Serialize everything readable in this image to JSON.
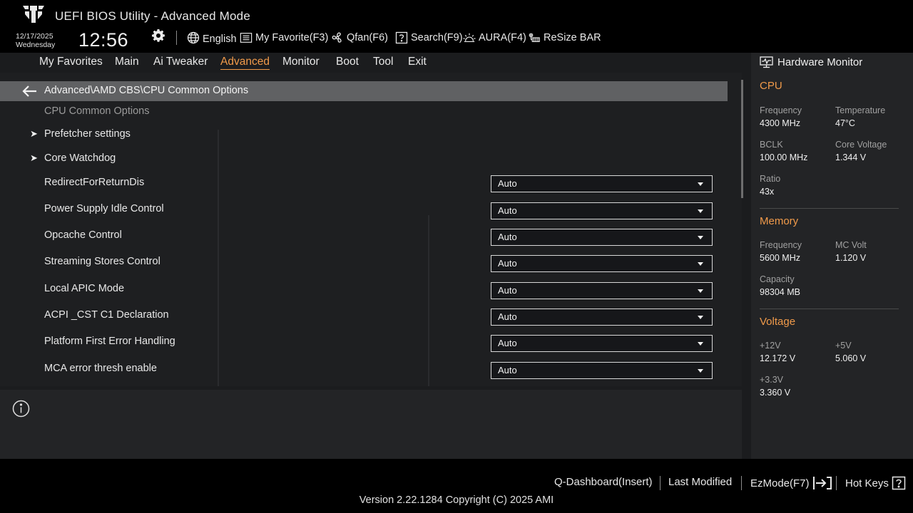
{
  "header": {
    "title": "UEFI BIOS Utility - Advanced Mode",
    "date": "12/17/2025",
    "day": "Wednesday",
    "time": "12:56",
    "tools": {
      "language": "English",
      "my_favorite": "My Favorite(F3)",
      "qfan": "Qfan(F6)",
      "search": "Search(F9)",
      "aura": "AURA(F4)",
      "resize_bar": "ReSize BAR"
    }
  },
  "nav": {
    "tabs": [
      "My Favorites",
      "Main",
      "Ai Tweaker",
      "Advanced",
      "Monitor",
      "Boot",
      "Tool",
      "Exit"
    ],
    "active": "Advanced"
  },
  "main": {
    "breadcrumb": "Advanced\\AMD CBS\\CPU Common Options",
    "section_title": "CPU Common Options",
    "submenus": [
      "Prefetcher settings",
      "Core Watchdog"
    ],
    "options": [
      {
        "label": "RedirectForReturnDis",
        "value": "Auto"
      },
      {
        "label": "Power Supply Idle Control",
        "value": "Auto"
      },
      {
        "label": "Opcache Control",
        "value": "Auto"
      },
      {
        "label": "Streaming Stores Control",
        "value": "Auto"
      },
      {
        "label": "Local APIC Mode",
        "value": "Auto"
      },
      {
        "label": "ACPI _CST C1 Declaration",
        "value": "Auto"
      },
      {
        "label": "Platform First Error Handling",
        "value": "Auto"
      },
      {
        "label": "MCA error thresh enable",
        "value": "Auto"
      }
    ]
  },
  "hardware_monitor": {
    "title": "Hardware Monitor",
    "cpu": {
      "title": "CPU",
      "frequency_label": "Frequency",
      "frequency": "4300 MHz",
      "temperature_label": "Temperature",
      "temperature": "47°C",
      "bclk_label": "BCLK",
      "bclk": "100.00 MHz",
      "core_voltage_label": "Core Voltage",
      "core_voltage": "1.344 V",
      "ratio_label": "Ratio",
      "ratio": "43x"
    },
    "memory": {
      "title": "Memory",
      "frequency_label": "Frequency",
      "frequency": "5600 MHz",
      "mc_volt_label": "MC Volt",
      "mc_volt": "1.120 V",
      "capacity_label": "Capacity",
      "capacity": "98304 MB"
    },
    "voltage": {
      "title": "Voltage",
      "v12_label": "+12V",
      "v12": "12.172 V",
      "v5_label": "+5V",
      "v5": "5.060 V",
      "v33_label": "+3.3V",
      "v33": "3.360 V"
    }
  },
  "footer": {
    "q_dashboard": "Q-Dashboard(Insert)",
    "last_modified": "Last Modified",
    "ezmode": "EzMode(F7)",
    "hot_keys": "Hot Keys",
    "version": "Version 2.22.1284 Copyright (C) 2025 AMI"
  },
  "colors": {
    "accent": "#f09a4a",
    "background": "#1e1f21",
    "bar": "#000000",
    "breadcrumb_bg": "#606163"
  }
}
